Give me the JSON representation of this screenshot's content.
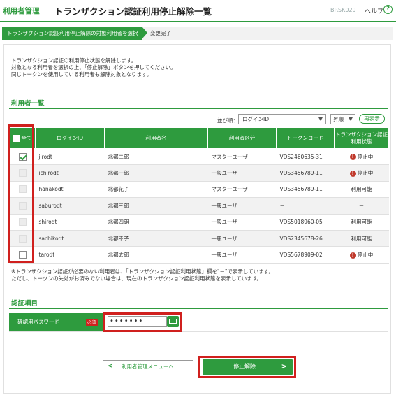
{
  "header": {
    "section": "利用者管理",
    "title": "トランザクション認証利用停止解除一覧",
    "screen_code": "BRSK029",
    "help_label": "ヘルプ",
    "help_icon": "?"
  },
  "steps": [
    {
      "label": "トランザクション認証利用停止解除の対象利用者を選択"
    },
    {
      "label": "変更完了"
    }
  ],
  "description": [
    "トランザクション認証の利用停止状態を解除します。",
    "対象となる利用者を選択の上、「停止解除」ボタンを押してください。",
    "同じトークンを使用している利用者も解除対象となります。"
  ],
  "user_list": {
    "title": "利用者一覧",
    "sort_label": "並び順：",
    "sort_value": "ログインID",
    "order_value": "昇順",
    "redisplay_label": "再表示",
    "columns": {
      "all": "全て",
      "login_id": "ログインID",
      "user_name": "利用者名",
      "user_type": "利用者区分",
      "token_code": "トークンコード",
      "status_line1": "トランザクション認証",
      "status_line2": "利用状態"
    },
    "rows": [
      {
        "login_id": "jirodt",
        "user_name": "北都二郎",
        "user_type": "マスターユーザ",
        "token_code": "VDS2460635-31",
        "status": "停止中",
        "checked": true,
        "disabled": false,
        "stopped": true
      },
      {
        "login_id": "ichirodt",
        "user_name": "北都一郎",
        "user_type": "一般ユーザ",
        "token_code": "VDS3456789-11",
        "status": "停止中",
        "checked": false,
        "disabled": true,
        "stopped": true
      },
      {
        "login_id": "hanakodt",
        "user_name": "北都花子",
        "user_type": "マスターユーザ",
        "token_code": "VDS3456789-11",
        "status": "利用可能",
        "checked": false,
        "disabled": true,
        "stopped": false
      },
      {
        "login_id": "saburodt",
        "user_name": "北都三郎",
        "user_type": "一般ユーザ",
        "token_code": "－",
        "status": "－",
        "checked": false,
        "disabled": true,
        "stopped": false
      },
      {
        "login_id": "shirodt",
        "user_name": "北都四朗",
        "user_type": "一般ユーザ",
        "token_code": "VDS5018960-05",
        "status": "利用可能",
        "checked": false,
        "disabled": true,
        "stopped": false
      },
      {
        "login_id": "sachikodt",
        "user_name": "北都幸子",
        "user_type": "一般ユーザ",
        "token_code": "VDS2345678-26",
        "status": "利用可能",
        "checked": false,
        "disabled": true,
        "stopped": false
      },
      {
        "login_id": "tarodt",
        "user_name": "北都太郎",
        "user_type": "一般ユーザ",
        "token_code": "VDS5678909-02",
        "status": "停止中",
        "checked": false,
        "disabled": false,
        "stopped": true
      }
    ],
    "note": [
      "※トランザクション認証が必要のない利用者は、「トランザクション認証利用状態」欄を\"－\"で表示しています。",
      "ただし、トークンの失効がお済みでない場合は、現在のトランザクション認証利用状態を表示しています。"
    ]
  },
  "auth": {
    "title": "認証項目",
    "password_label": "確認用パスワード",
    "required_label": "必須",
    "password_value": "•••••••"
  },
  "buttons": {
    "back_label": "利用者管理メニューへ",
    "stop_release_label": "停止解除"
  },
  "colors": {
    "brand_green": "#2e9b3e",
    "highlight_red": "#d0201e",
    "stopped_icon": "#c0392b"
  }
}
